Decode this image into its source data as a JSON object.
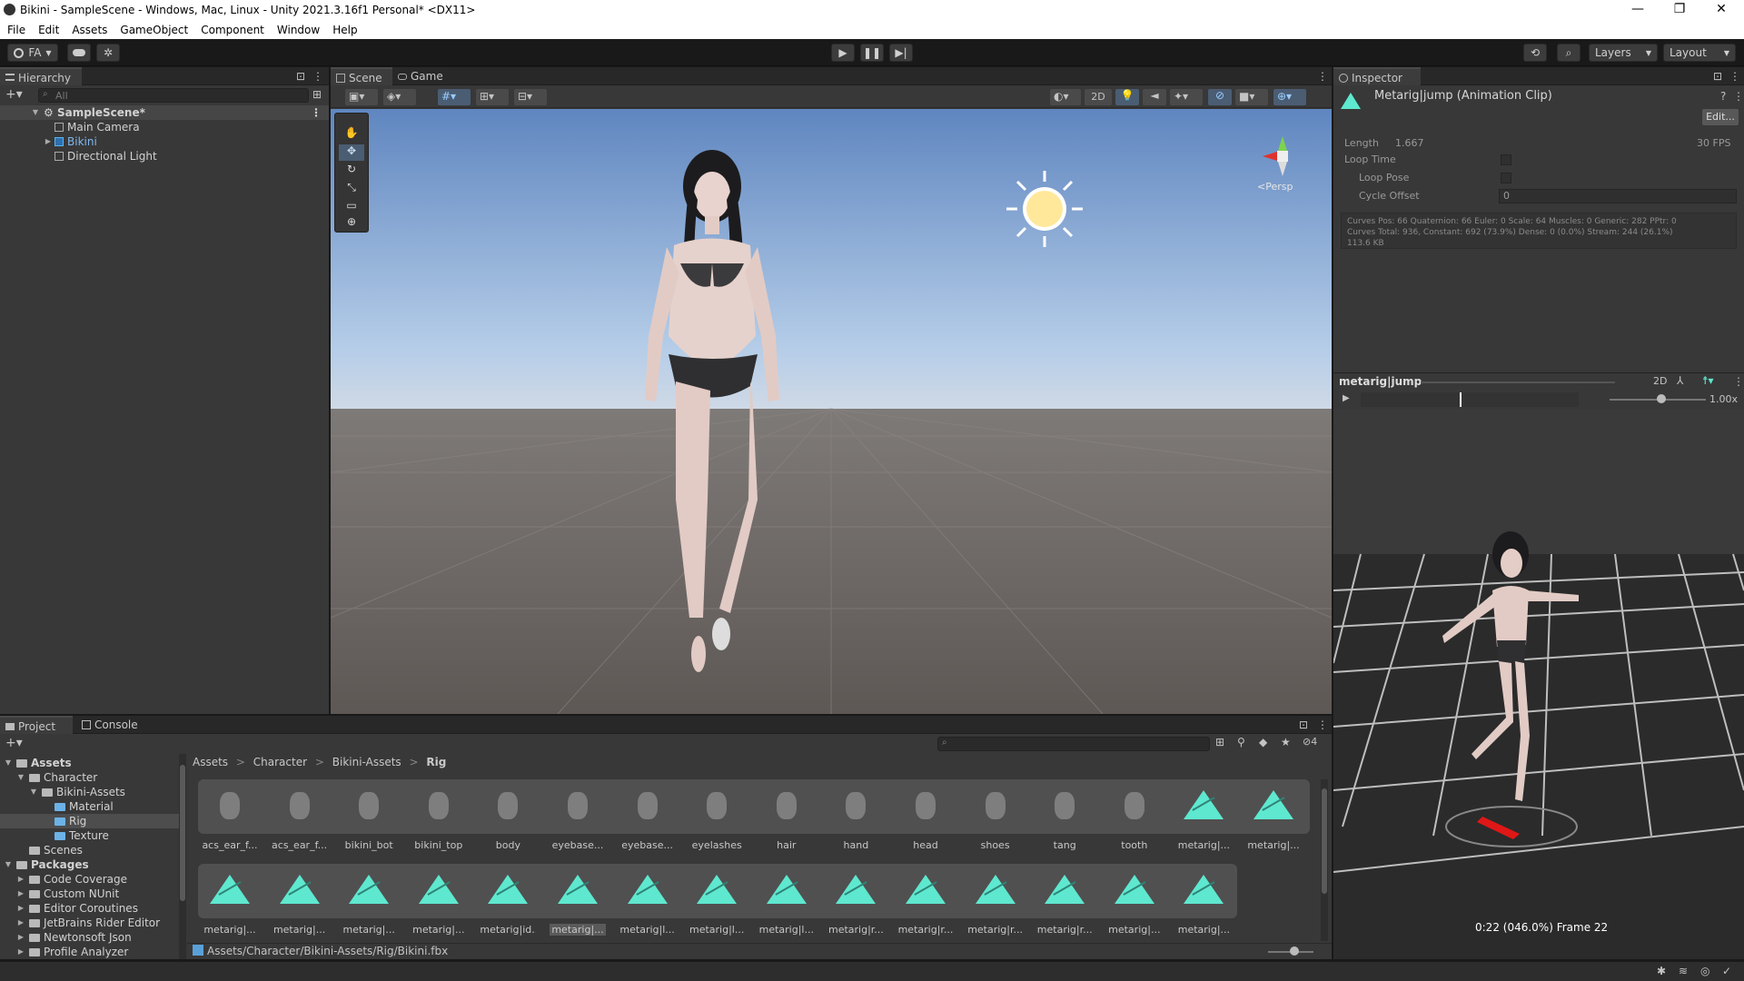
{
  "window": {
    "title": "Bikini - SampleScene - Windows, Mac, Linux - Unity 2021.3.16f1 Personal* <DX11>",
    "minimize": "—",
    "restore": "❐",
    "close": "✕"
  },
  "menu": [
    "File",
    "Edit",
    "Assets",
    "GameObject",
    "Component",
    "Window",
    "Help"
  ],
  "toolbar": {
    "account": "FA",
    "layers": "Layers",
    "layout": "Layout"
  },
  "hierarchy": {
    "tab": "Hierarchy",
    "search_placeholder": "All",
    "scene": "SampleScene*",
    "items": [
      "Main Camera",
      "Bikini",
      "Directional Light"
    ]
  },
  "scene_view": {
    "tabs": [
      "Scene",
      "Game"
    ],
    "mode_2d": "2D",
    "persp": "Persp"
  },
  "inspector": {
    "tab": "Inspector",
    "title": "Metarig|jump (Animation Clip)",
    "edit_button": "Edit...",
    "length_label": "Length",
    "length_value": "1.667",
    "fps": "30 FPS",
    "loop_time": "Loop Time",
    "loop_pose": "Loop Pose",
    "cycle_offset": "Cycle Offset",
    "cycle_offset_value": "0",
    "curves_line1": "Curves Pos: 66 Quaternion: 66 Euler: 0 Scale: 64 Muscles: 0 Generic: 282 PPtr: 0",
    "curves_line2": "Curves Total: 936, Constant: 692 (73.9%) Dense: 0 (0.0%) Stream: 244 (26.1%)",
    "size": "113.6 KB"
  },
  "preview": {
    "title": "metarig|jump",
    "mode_2d": "2D",
    "speed": "1.00x",
    "status": "0:22 (046.0%) Frame 22",
    "progress": 0.46
  },
  "project": {
    "tabs": [
      "Project",
      "Console"
    ],
    "hidden_count": "4",
    "tree": {
      "assets": "Assets",
      "character": "Character",
      "bikini_assets": "Bikini-Assets",
      "material": "Material",
      "rig": "Rig",
      "texture": "Texture",
      "scenes": "Scenes",
      "packages": "Packages",
      "packages_items": [
        "Code Coverage",
        "Custom NUnit",
        "Editor Coroutines",
        "JetBrains Rider Editor",
        "Newtonsoft Json",
        "Profile Analyzer"
      ]
    },
    "breadcrumb": [
      "Assets",
      "Character",
      "Bikini-Assets",
      "Rig"
    ],
    "breadcrumb_sep": ">",
    "grid_row1": [
      "acs_ear_f...",
      "acs_ear_f...",
      "bikini_bot",
      "bikini_top",
      "body",
      "eyebase...",
      "eyebase...",
      "eyelashes",
      "hair",
      "hand",
      "head",
      "shoes",
      "tang",
      "tooth",
      "metarig|...",
      "metarig|..."
    ],
    "grid_row2": [
      "metarig|...",
      "metarig|...",
      "metarig|...",
      "metarig|...",
      "metarig|id...",
      "metarig|...",
      "metarig|l...",
      "metarig|l...",
      "metarig|l...",
      "metarig|r...",
      "metarig|r...",
      "metarig|r...",
      "metarig|r...",
      "metarig|...",
      "metarig|..."
    ],
    "path": "Assets/Character/Bikini-Assets/Rig/Bikini.fbx"
  },
  "colors": {
    "anim_clip": "#5ee8cf",
    "selection": "#2c5d87",
    "panel": "#383838"
  }
}
